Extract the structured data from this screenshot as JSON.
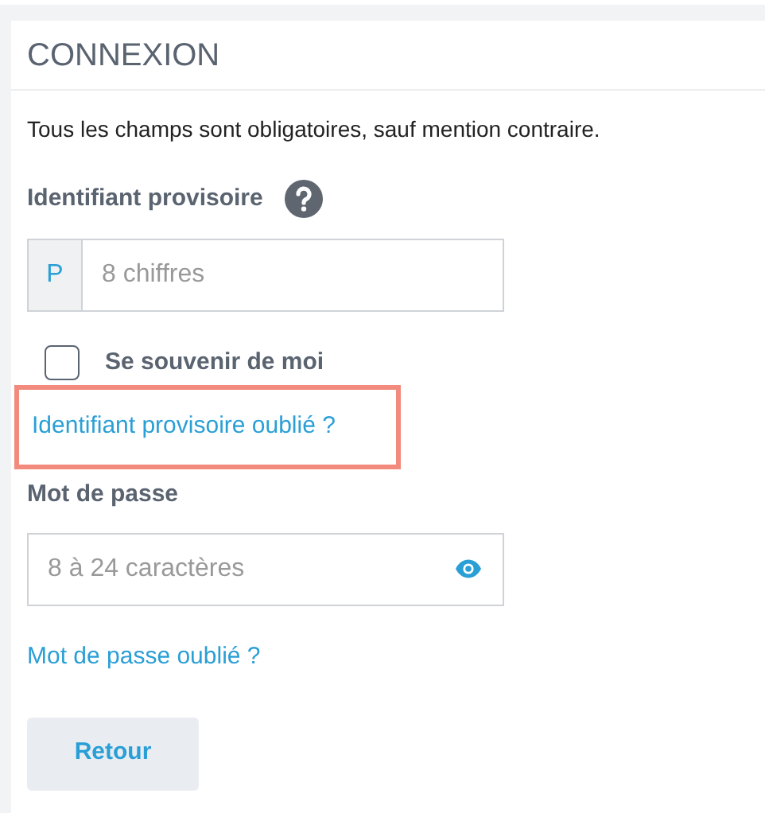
{
  "section": {
    "title": "CONNEXION"
  },
  "note": "Tous les champs sont obligatoires, sauf mention contraire.",
  "id_field": {
    "label": "Identifiant provisoire",
    "prefix": "P",
    "placeholder": "8 chiffres"
  },
  "remember": {
    "label": "Se souvenir de moi",
    "checked": false
  },
  "forgot_id": {
    "label": "Identifiant provisoire oublié ?",
    "highlighted": true
  },
  "password_field": {
    "label": "Mot de passe",
    "placeholder": "8 à 24 caractères"
  },
  "forgot_password": {
    "label": "Mot de passe oublié ?",
    "highlighted": false
  },
  "buttons": [
    "Retour"
  ]
}
